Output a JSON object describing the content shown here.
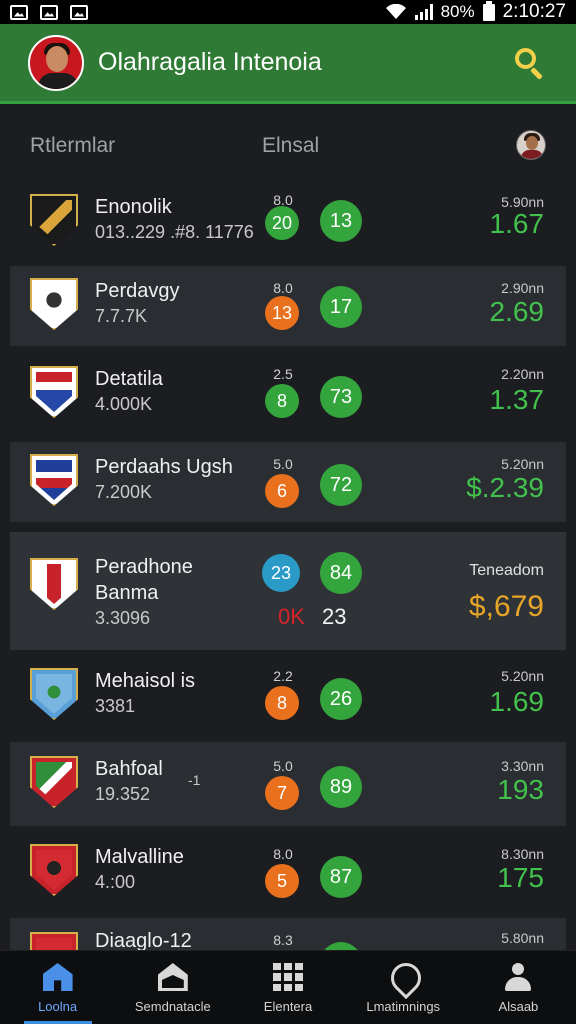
{
  "status": {
    "battery": "80%",
    "time": "2:10:27"
  },
  "header": {
    "title": "Olahragalia Intenoia"
  },
  "columns": {
    "left": "Rtlermlar",
    "mid": "Elnsal"
  },
  "rows": [
    {
      "name": "Enonolik",
      "sub": "013..229 .#8. 11776",
      "meta": "8.0",
      "b1": "20",
      "b2": "13",
      "rlabel": "5.90nn",
      "rvalue": "1.67"
    },
    {
      "name": "Perdavgy",
      "sub": "7.7.7K",
      "meta": "8.0",
      "b1": "13",
      "b2": "17",
      "rlabel": "2.90nn",
      "rvalue": "2.69"
    },
    {
      "name": "Detatila",
      "sub": "4.000K",
      "meta": "2.5",
      "b1": "8",
      "b2": "73",
      "rlabel": "2.20nn",
      "rvalue": "1.37"
    },
    {
      "name": "Perdaahs Ugsh",
      "sub": "7.200K",
      "meta": "5.0",
      "b1": "6",
      "b2": "72",
      "rlabel": "5.20nn",
      "rvalue": "$.2.39"
    },
    {
      "name": "Peradhone",
      "name2": "Banma",
      "sub": "3.3096",
      "b1": "23",
      "b2": "84",
      "red": "0K",
      "white": "23",
      "rlabel": "Teneadom",
      "rvalue": "$,679"
    },
    {
      "name": "Mehaisol is",
      "sub": "3381",
      "meta": "2.2",
      "b1": "8",
      "b2": "26",
      "rlabel": "5.20nn",
      "rvalue": "1.69"
    },
    {
      "name": "Bahfoal",
      "sub": "19.352",
      "extra": "-1",
      "meta": "5.0",
      "b1": "7",
      "b2": "89",
      "rlabel": "3.30nn",
      "rvalue": "193"
    },
    {
      "name": "Malvalline",
      "sub": "4.:00",
      "meta": "8.0",
      "b1": "5",
      "b2": "87",
      "rlabel": "8.30nn",
      "rvalue": "175"
    },
    {
      "name": "Diaaglo-12",
      "meta": "8.3",
      "rlabel": "5.80nn"
    }
  ],
  "nav": [
    {
      "label": "Loolna",
      "icon": "home-icon"
    },
    {
      "label": "Semdnatacle",
      "icon": "house-outline-icon"
    },
    {
      "label": "Elentera",
      "icon": "grid-icon"
    },
    {
      "label": "Lmatimnings",
      "icon": "location-pin-icon"
    },
    {
      "label": "Alsaab",
      "icon": "user-icon"
    }
  ],
  "colors": {
    "accent": "#2f7a34",
    "positive": "#42c24c",
    "gold": "#e7a628",
    "orange": "#e9711e",
    "blue": "#2a9bc6"
  }
}
